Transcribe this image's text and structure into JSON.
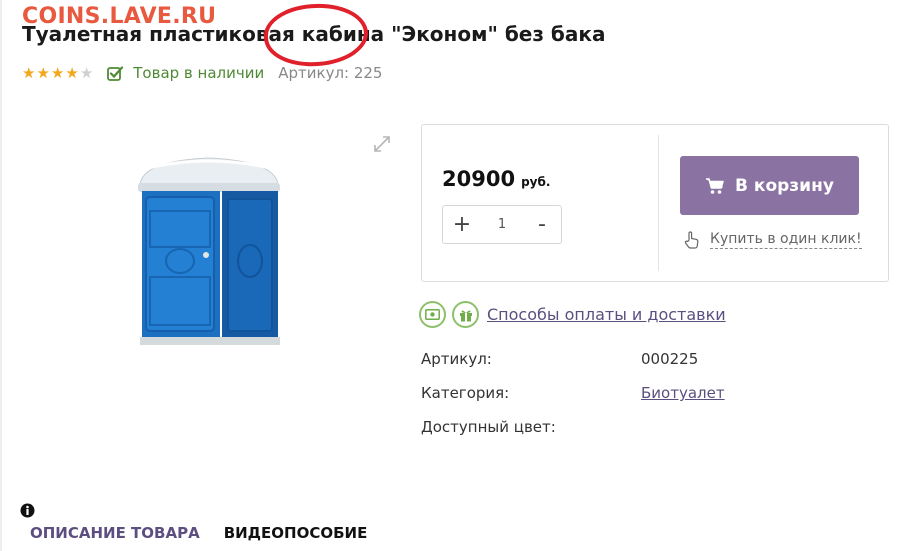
{
  "watermark": "COINS.LAVE.RU",
  "product": {
    "title": "Туалетная пластиковая кабина \"Эконом\" без бака",
    "rating": 4,
    "rating_max": 5,
    "stock_text": "Товар в наличии",
    "sku_inline": "Артикул: 225"
  },
  "buy": {
    "price": "20900",
    "currency": "руб.",
    "qty_plus": "+",
    "qty_value": "1",
    "qty_minus": "-",
    "cart_label": "В корзину",
    "oneclick_label": "Купить в один клик!"
  },
  "delivery": {
    "link": "Способы оплаты и доставки"
  },
  "props": [
    {
      "label": "Артикул:",
      "value": "000225",
      "link": false
    },
    {
      "label": "Категория:",
      "value": "Биотуалет",
      "link": true
    },
    {
      "label": "Доступный цвет:",
      "value": "",
      "link": false
    }
  ],
  "tabs": [
    "ОПИСАНИЕ ТОВАРА",
    "ВИДЕОПОСОБИЕ"
  ],
  "colors": {
    "accent": "#8a73a2",
    "star": "#f2a81d",
    "stock": "#4e8a34",
    "link": "#5c4f80",
    "annotation": "#e0202a"
  },
  "icons": {
    "stock": "check-square-icon",
    "expand": "expand-arrows-icon",
    "cart": "cart-icon",
    "oneclick": "hand-pointer-icon",
    "payment": "money-icon",
    "delivery": "gift-icon",
    "info": "info-circle-icon"
  }
}
